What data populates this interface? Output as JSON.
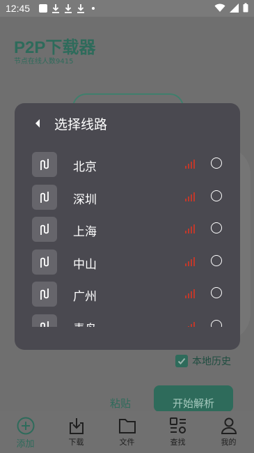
{
  "status": {
    "time": "12:45"
  },
  "app": {
    "title": "P2P下载器",
    "subtitle": "节点在线人数9415"
  },
  "history": {
    "label": "本地历史",
    "checked": true
  },
  "actions": {
    "paste_label": "粘贴",
    "start_label": "开始解析"
  },
  "nav": [
    {
      "icon": "plus-circle-icon",
      "label": "添加",
      "active": true
    },
    {
      "icon": "download-icon",
      "label": "下载",
      "active": false
    },
    {
      "icon": "folder-icon",
      "label": "文件",
      "active": false
    },
    {
      "icon": "search-grid-icon",
      "label": "查找",
      "active": false
    },
    {
      "icon": "person-icon",
      "label": "我的",
      "active": false
    }
  ],
  "dialog": {
    "title": "选择线路",
    "routes": [
      {
        "name": "北京",
        "signal_color": "#c0392b",
        "selected": false
      },
      {
        "name": "深圳",
        "signal_color": "#c0392b",
        "selected": false
      },
      {
        "name": "上海",
        "signal_color": "#c0392b",
        "selected": false
      },
      {
        "name": "中山",
        "signal_color": "#c0392b",
        "selected": false
      },
      {
        "name": "广州",
        "signal_color": "#c0392b",
        "selected": false
      },
      {
        "name": "青岛",
        "signal_color": "#c0392b",
        "selected": false
      }
    ]
  },
  "colors": {
    "accent": "#2e6b5b",
    "dialog_bg": "#4a4950",
    "signal": "#c0392b"
  }
}
